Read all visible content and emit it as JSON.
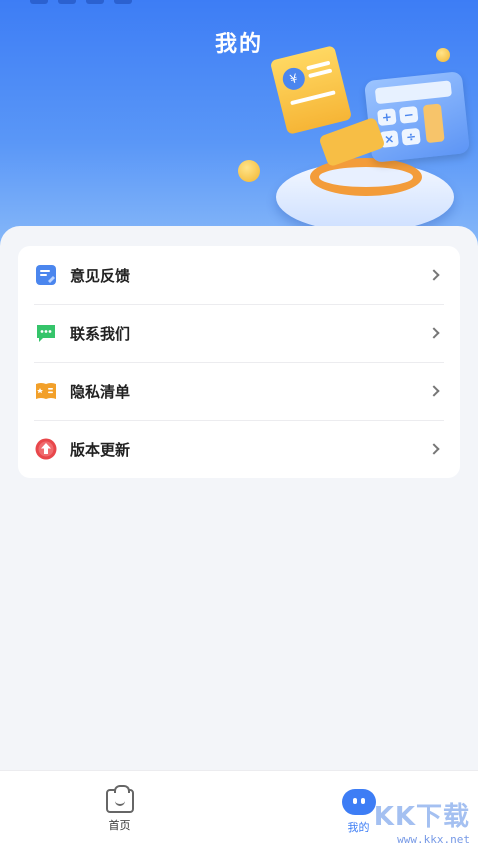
{
  "page": {
    "title": "我的"
  },
  "menu": {
    "items": [
      {
        "label": "意见反馈",
        "icon": "feedback-icon",
        "color": "#4b86ee"
      },
      {
        "label": "联系我们",
        "icon": "chat-icon",
        "color": "#35c46a"
      },
      {
        "label": "隐私清单",
        "icon": "privacy-list-icon",
        "color": "#f2a02a"
      },
      {
        "label": "版本更新",
        "icon": "update-icon",
        "color": "#e8474b"
      }
    ]
  },
  "tabbar": {
    "tabs": [
      {
        "label": "首页",
        "icon": "home-icon",
        "active": false
      },
      {
        "label": "我的",
        "icon": "profile-icon",
        "active": true
      }
    ],
    "accent": "#3d7df5"
  },
  "illustration": {
    "currency_symbol": "¥",
    "calc_keys": [
      "+",
      "−",
      "×",
      "÷"
    ]
  },
  "watermark": {
    "title": "KK下载",
    "url": "www.kkx.net"
  }
}
